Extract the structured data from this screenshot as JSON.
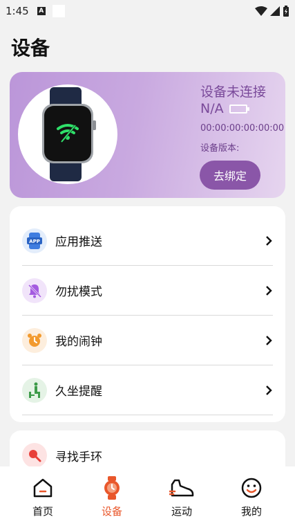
{
  "status_bar": {
    "time": "1:45",
    "indicator": "A"
  },
  "page": {
    "title": "设备"
  },
  "device": {
    "status": "设备未连接",
    "battery_text": "N/A",
    "mac": "00:00:00:00:00:00",
    "version_label": "设备版本:",
    "unbind_label": "去绑定"
  },
  "menu": {
    "items": [
      {
        "label": "应用推送",
        "icon": "app-push-icon"
      },
      {
        "label": "勿扰模式",
        "icon": "do-not-disturb-icon"
      },
      {
        "label": "我的闹钟",
        "icon": "alarm-clock-icon"
      },
      {
        "label": "久坐提醒",
        "icon": "sedentary-reminder-icon"
      }
    ]
  },
  "find": {
    "label": "寻找手环",
    "icon": "find-band-icon"
  },
  "nav": {
    "items": [
      {
        "label": "首页",
        "icon": "home-icon",
        "active": false
      },
      {
        "label": "设备",
        "icon": "watch-icon",
        "active": true
      },
      {
        "label": "运动",
        "icon": "shoe-icon",
        "active": false
      },
      {
        "label": "我的",
        "icon": "smiley-icon",
        "active": false
      }
    ]
  },
  "colors": {
    "accent": "#e9572b",
    "card_gradient_start": "#bb96d9",
    "card_gradient_end": "#e6d5ef",
    "unbind_button": "#8a56a8"
  }
}
